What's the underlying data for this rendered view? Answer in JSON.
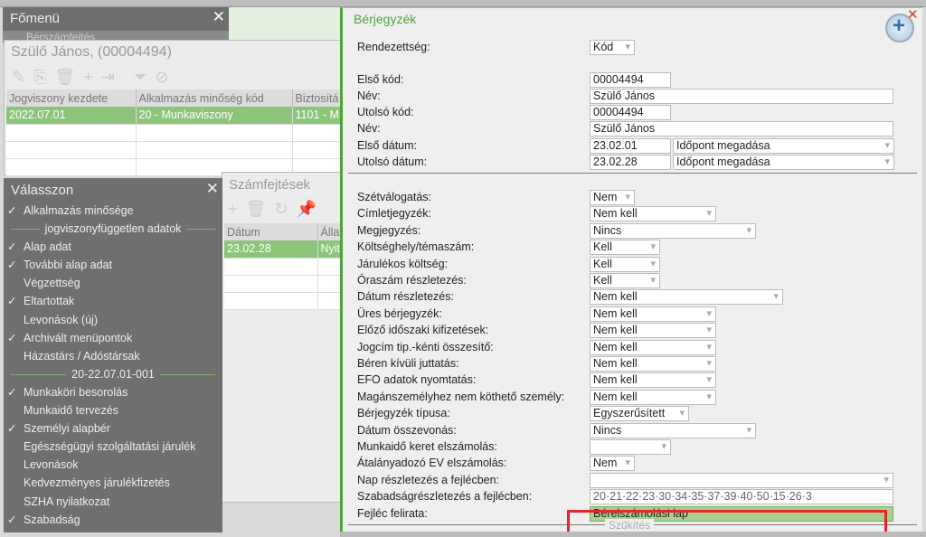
{
  "main_menu": {
    "title": "Főmenü",
    "item": "Bérszámfejtés"
  },
  "person": {
    "title": "Szülő János, (00004494)",
    "columns": [
      "Jogviszony kezdete",
      "Alkalmazás minőség kód",
      "Biztosítá"
    ],
    "rows": [
      [
        "2022.07.01",
        "20 - Munkaviszony",
        "1101 - M"
      ]
    ]
  },
  "select_panel": {
    "title": "Válasszon",
    "items": [
      {
        "label": "Alkalmazás minősége",
        "checked": true
      },
      {
        "label": "jogviszonyfüggetlen adatok",
        "separator": true
      },
      {
        "label": "Alap adat",
        "checked": true
      },
      {
        "label": "További alap adat",
        "checked": true
      },
      {
        "label": "Végzettség",
        "checked": false
      },
      {
        "label": "Eltartottak",
        "checked": true
      },
      {
        "label": "Levonások (új)",
        "checked": false
      },
      {
        "label": "Archivált menüpontok",
        "checked": true
      },
      {
        "label": "Házastárs / Adóstársak",
        "checked": false
      },
      {
        "label": "20-22.07.01-001",
        "separator": true
      },
      {
        "label": "Munkaköri besorolás",
        "checked": true
      },
      {
        "label": "Munkaidő tervezés",
        "checked": false
      },
      {
        "label": "Személyi alapbér",
        "checked": true
      },
      {
        "label": "Egészségügyi szolgáltatási járulék",
        "checked": false
      },
      {
        "label": "Levonások",
        "checked": false
      },
      {
        "label": "Kedvezményes járulékfizetés",
        "checked": false
      },
      {
        "label": "SZHA nyilatkozat",
        "checked": false
      },
      {
        "label": "Szabadság",
        "checked": true
      }
    ]
  },
  "payroll": {
    "title": "Számfejtések",
    "columns": [
      "Dátum",
      "Álla"
    ],
    "rows": [
      [
        "23.02.28",
        "Nyit"
      ]
    ]
  },
  "dialog": {
    "title": "Bérjegyzék",
    "top_fields": [
      {
        "label": "Rendezettség:",
        "value": "Kód",
        "type": "dropdown"
      },
      {
        "label": "Első kód:",
        "value": "00004494",
        "type": "text"
      },
      {
        "label": "Név:",
        "value": "Szülő János",
        "type": "text"
      },
      {
        "label": "Utolsó kód:",
        "value": "00004494",
        "type": "text"
      },
      {
        "label": "Név:",
        "value": "Szülő János",
        "type": "text"
      },
      {
        "label": "Első dátum:",
        "value": "23.02.01",
        "extra": "Időpont megadása",
        "type": "date"
      },
      {
        "label": "Utolsó dátum:",
        "value": "23.02.28",
        "extra": "Időpont megadása",
        "type": "date"
      }
    ],
    "fields": [
      {
        "label": "Szétválogatás:",
        "value": "Nem"
      },
      {
        "label": "Címletjegyzék:",
        "value": "Nem kell"
      },
      {
        "label": "Megjegyzés:",
        "value": "Nincs"
      },
      {
        "label": "Költséghely/témaszám:",
        "value": "Kell"
      },
      {
        "label": "Járulékos költség:",
        "value": "Kell"
      },
      {
        "label": "Óraszám részletezés:",
        "value": "Kell"
      },
      {
        "label": "Dátum részletezés:",
        "value": "Nem kell"
      },
      {
        "label": "Üres bérjegyzék:",
        "value": "Nem kell"
      },
      {
        "label": "Előző időszaki kifizetések:",
        "value": "Nem kell"
      },
      {
        "label": "Jogcím tip.-kénti összesítő:",
        "value": "Nem kell"
      },
      {
        "label": "Béren kívüli juttatás:",
        "value": "Nem kell"
      },
      {
        "label": "EFO adatok nyomtatás:",
        "value": "Nem kell"
      },
      {
        "label": "Magánszemélyhez nem köthető személy:",
        "value": "Nem kell"
      },
      {
        "label": "Bérjegyzék típusa:",
        "value": "Egyszerűsített"
      },
      {
        "label": "Dátum összevonás:",
        "value": "Nincs"
      },
      {
        "label": "Munkaidő keret elszámolás:",
        "value": ""
      },
      {
        "label": "Átalányadozó EV elszámolás:",
        "value": "Nem"
      },
      {
        "label": "Nap részletezés a fejlécben:",
        "value": ""
      },
      {
        "label": "Szabadságrészletezés a fejlécben:",
        "value": "20·21·22·23·30·34·35·37·39·40·50·15·26·3"
      },
      {
        "label": "Fejléc felirata:",
        "value": "Bérelszámolási lap"
      }
    ],
    "section": "Szűkítés"
  },
  "highlight_color": "#e8232b",
  "accent": "#4ea33a"
}
